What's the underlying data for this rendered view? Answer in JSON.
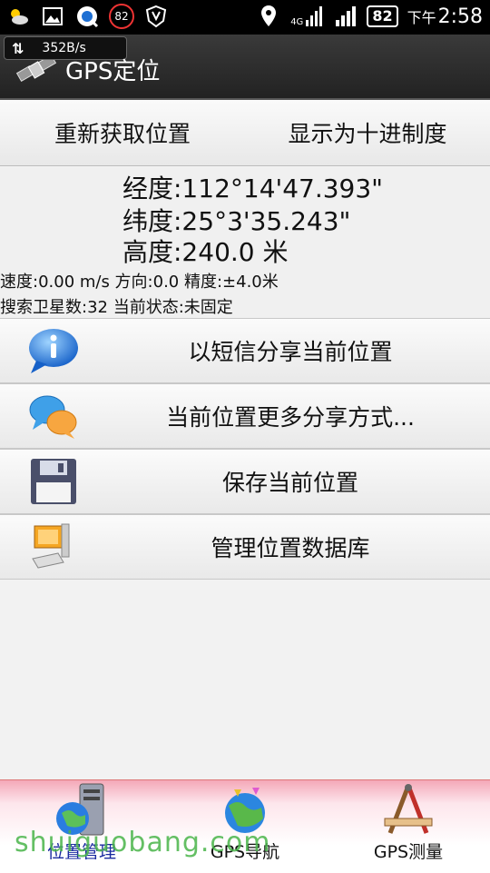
{
  "status_bar": {
    "badge_speed": "82",
    "battery": "82",
    "network": "4G",
    "time_prefix": "下午",
    "time": "2:58"
  },
  "title_bar": {
    "traffic_rate": "352B/s",
    "title": "GPS定位"
  },
  "top_buttons": {
    "refresh": "重新获取位置",
    "decimal": "显示为十进制度"
  },
  "info": {
    "longitude": "经度:112°14'47.393\"",
    "latitude": "纬度:25°3'35.243\"",
    "altitude": "高度:240.0 米",
    "motion": "速度:0.00 m/s 方向:0.0 精度:±4.0米",
    "satellites": "搜索卫星数:32 当前状态:未固定"
  },
  "actions": [
    {
      "label": "以短信分享当前位置",
      "icon": "info-bubble-icon"
    },
    {
      "label": "当前位置更多分享方式...",
      "icon": "chat-bubbles-icon"
    },
    {
      "label": "保存当前位置",
      "icon": "floppy-disk-icon"
    },
    {
      "label": "管理位置数据库",
      "icon": "computer-icon"
    }
  ],
  "tabs": [
    {
      "label": "位置管理",
      "icon": "server-globe-icon",
      "active": true
    },
    {
      "label": "GPS导航",
      "icon": "globe-icon",
      "active": false
    },
    {
      "label": "GPS测量",
      "icon": "compass-ruler-icon",
      "active": false
    }
  ],
  "watermark": "shuiguobang.com"
}
